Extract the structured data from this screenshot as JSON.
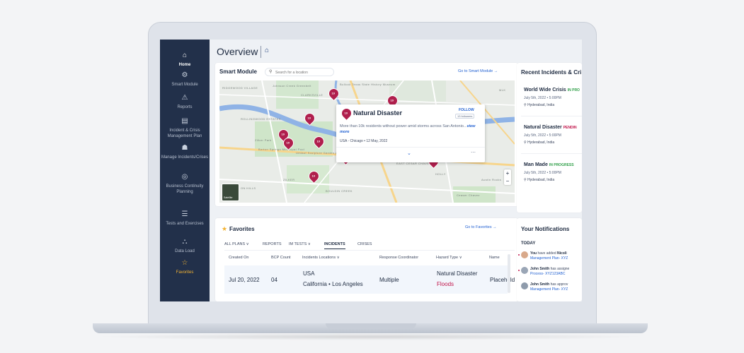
{
  "page": {
    "title": "Overview",
    "home_icon": "home-icon"
  },
  "sidebar": {
    "items": [
      {
        "label": "Home",
        "icon": "home-icon"
      },
      {
        "label": "Smart Module",
        "icon": "gear-icon"
      },
      {
        "label": "Reports",
        "icon": "warning-icon"
      },
      {
        "label": "Incident & Crisis Management Plan",
        "icon": "document-icon"
      },
      {
        "label": "Manage Incidents/Crises",
        "icon": "people-icon"
      },
      {
        "label": "Business Continuity Planning",
        "icon": "globe-icon"
      },
      {
        "label": "Tests and Exercises",
        "icon": "checklist-icon"
      },
      {
        "label": "Data Load",
        "icon": "hierarchy-icon"
      },
      {
        "label": "Favorites",
        "icon": "star-icon"
      }
    ]
  },
  "smart_module": {
    "title": "Smart Module",
    "search_placeholder": "Search for a location",
    "link": "Go to Smart Module →",
    "map_labels": [
      "RIDGEWOOD VILLAGE",
      "CLARKSVILLE",
      "Johnson Creek Greenbelt",
      "Bullock Texas State History Museum",
      "ROLLINGWOOD ESTATES",
      "Zilker Park",
      "Barton Springs Municipal Pool",
      "ZILKER",
      "BOULDIN CREEK",
      "EAST CESAR CHAVEZ",
      "HOLLY",
      "Austin Rocks",
      "Ceaser Chavez",
      "MLK",
      "ON HILLS",
      "Umlauf Sculpture Garden & Museum"
    ],
    "satellite_label": "Satellite",
    "pins": [
      "10",
      "10",
      "10",
      "10",
      "10",
      "10",
      "10",
      "10",
      "10",
      "10",
      "10",
      "10"
    ],
    "popup": {
      "title": "Natural Disaster",
      "pin_count": "10",
      "follow": "FOLLOW",
      "followers": "13 followers",
      "description": "More than 10k residents without power amid storms across San Antonio...",
      "view_more": "view more",
      "location": "USA - Chicago",
      "date": "12 May, 2022"
    }
  },
  "favorites": {
    "title": "Favorites",
    "link": "Go to Favorites →",
    "tabs": [
      "ALL PLANS ∨",
      "REPORTS",
      "IM TESTS ∨",
      "INCIDENTS",
      "CRISES"
    ],
    "active_tab": "INCIDENTS",
    "columns": [
      "Created On",
      "BCP Count",
      "Incidents Locations ∨",
      "Response Coordinator",
      "Hazard Type ∨",
      "Name"
    ],
    "row": {
      "created_on": "Jul 20, 2022",
      "bcp_count": "04",
      "location_country": "USA",
      "location_state": "California",
      "location_city": "Los Angeles",
      "coordinator": "Multiple",
      "hazard_type": "Natural Disaster",
      "hazard_subtype": "Floods",
      "name": "Placehold"
    }
  },
  "recent_incidents": {
    "title": "Recent Incidents & Cri",
    "items": [
      {
        "name": "World Wide Crisis",
        "status": "IN PRO",
        "status_color": "#2e9e47",
        "date": "July 5th, 2022",
        "time": "5:00PM",
        "location": "Hyderabad, India"
      },
      {
        "name": "Natural Disaster",
        "status": "PENDIN",
        "status_color": "#c1154a",
        "date": "July 5th, 2022",
        "time": "5:00PM",
        "location": "Hyderabad, India"
      },
      {
        "name": "Man Made",
        "status": "IN PROGRESS",
        "status_color": "#2e9e47",
        "date": "July 5th, 2022",
        "time": "5:00PM",
        "location": "Hyderabad, India"
      }
    ]
  },
  "notifications": {
    "title": "Your Notifications",
    "section": "TODAY",
    "items": [
      {
        "actor": "You",
        "action": "have added",
        "object": "Nicoli",
        "link": "Management Plan- XYZ"
      },
      {
        "actor": "John Smith",
        "action": "has assigne",
        "object": "",
        "link": "Process- XYZ123ABC"
      },
      {
        "actor": "John Smith",
        "action": "has approv",
        "object": "",
        "link": "Management Plan- XYZ"
      }
    ]
  },
  "colors": {
    "sidebar": "#22304a",
    "accent": "#1f5fd1",
    "pin": "#b01f4d",
    "favorite": "#f2b233"
  }
}
